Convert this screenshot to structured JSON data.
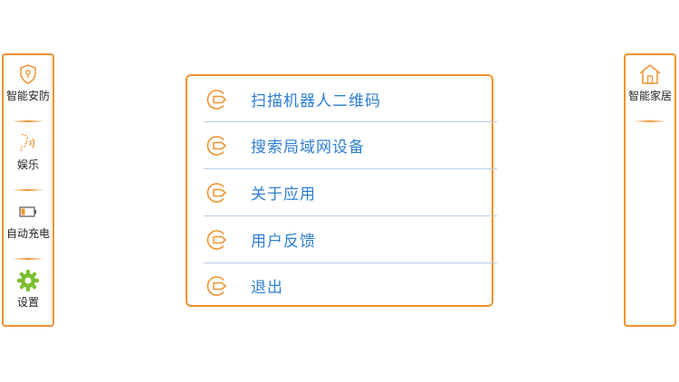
{
  "left_panel": {
    "items": [
      {
        "label": "智能安防",
        "icon": "security-shield-icon"
      },
      {
        "label": "娱乐",
        "icon": "voice-icon"
      },
      {
        "label": "自动充电",
        "icon": "battery-icon"
      },
      {
        "label": "设置",
        "icon": "gear-icon"
      }
    ]
  },
  "right_panel": {
    "items": [
      {
        "label": "智能家居",
        "icon": "home-icon"
      }
    ]
  },
  "menu": {
    "items": [
      {
        "label": "扫描机器人二维码",
        "icon": "menu-arrow-icon"
      },
      {
        "label": "搜索局域网设备",
        "icon": "menu-arrow-icon"
      },
      {
        "label": "关于应用",
        "icon": "menu-arrow-icon"
      },
      {
        "label": "用户反馈",
        "icon": "menu-arrow-icon"
      },
      {
        "label": "退出",
        "icon": "menu-arrow-icon"
      }
    ]
  },
  "colors": {
    "accent_orange": "#f0922e",
    "menu_text_blue": "#2d7fd2",
    "gear_green": "#7cbe2f",
    "separator_blue": "#b8cee6"
  }
}
